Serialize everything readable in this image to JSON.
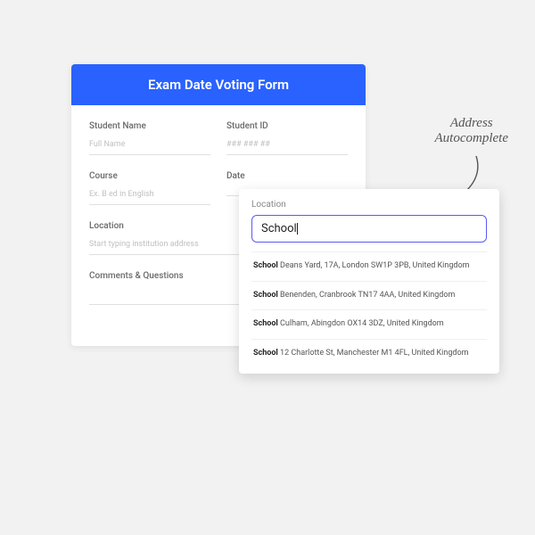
{
  "form": {
    "title": "Exam Date Voting Form",
    "fields": {
      "student_name": {
        "label": "Student Name",
        "placeholder": "Full Name"
      },
      "student_id": {
        "label": "Student ID",
        "placeholder": "### ### ##"
      },
      "course": {
        "label": "Course",
        "placeholder": "Ex. B ed in English"
      },
      "date": {
        "label": "Date",
        "placeholder": ""
      },
      "location": {
        "label": "Location",
        "placeholder": "Start typing institution address"
      },
      "comments": {
        "label": "Comments & Questions"
      }
    }
  },
  "annotation": {
    "line1": "Address",
    "line2": "Autocomplete"
  },
  "autocomplete": {
    "label": "Location",
    "query": "School",
    "suggestions": [
      {
        "bold": "School",
        "rest": " Deans Yard, 17A, London SW1P 3PB, United Kingdom"
      },
      {
        "bold": "School",
        "rest": " Benenden, Cranbrook TN17 4AA, United Kingdom"
      },
      {
        "bold": "School",
        "rest": " Culham, Abingdon OX14 3DZ, United Kingdom"
      },
      {
        "bold": "School",
        "rest": " 12 Charlotte St, Manchester M1 4FL, United Kingdom"
      }
    ]
  }
}
